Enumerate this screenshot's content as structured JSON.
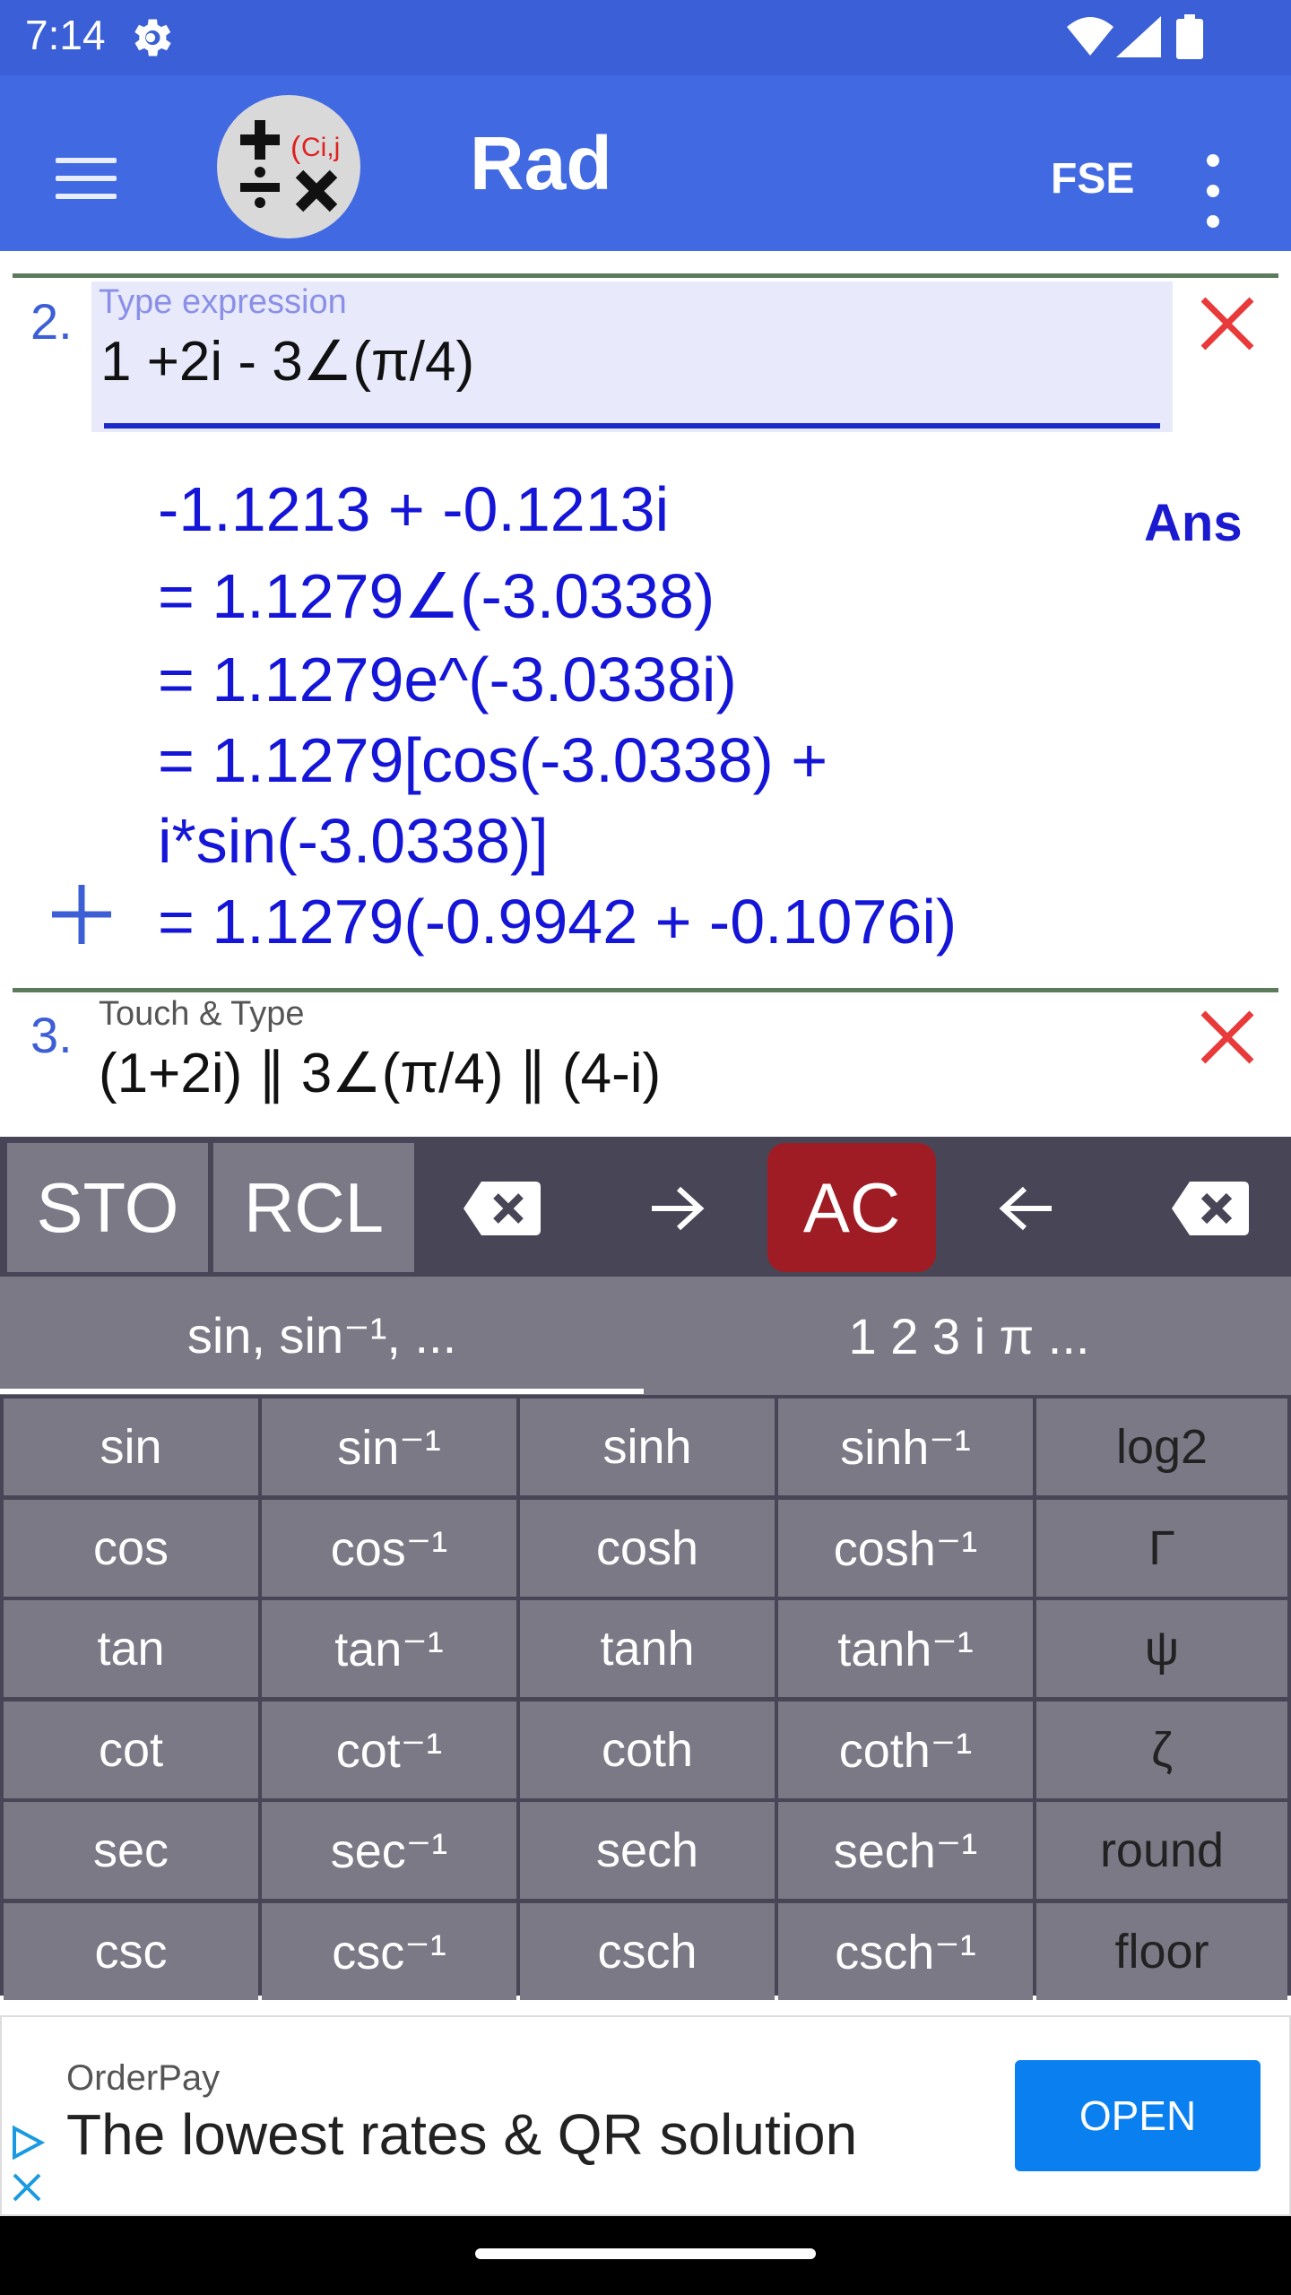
{
  "status_bar": {
    "time": "7:14",
    "icons": [
      "gear-icon",
      "wifi-icon",
      "signal-icon",
      "battery-icon"
    ]
  },
  "app_bar": {
    "icons": [
      "menu-icon",
      "more-vert-icon"
    ],
    "logo_text": "Ci,j",
    "title": "Rad",
    "fse_label": "FSE"
  },
  "entry2": {
    "number": "2.",
    "label": "Type expression",
    "expression": "1 +2i - 3∠(π/4)",
    "results": [
      "-1.1213 + -0.1213i",
      "= 1.1279∠(-3.0338)",
      "= 1.1279e^(-3.0338i)",
      "= 1.1279[cos(-3.0338) +",
      "i*sin(-3.0338)]",
      "= 1.1279(-0.9942 + -0.1076i)"
    ],
    "ans_label": "Ans"
  },
  "entry3": {
    "number": "3.",
    "label": "Touch & Type",
    "expression": "(1+2i) ∥ 3∠(π/4) ∥ (4-i)"
  },
  "toolbar": {
    "sto": "STO",
    "rcl": "RCL",
    "ac": "AC",
    "icons": [
      "clear-entry-icon",
      "arrow-right-icon",
      "arrow-left-icon",
      "backspace-icon"
    ]
  },
  "tabs": [
    {
      "label": "sin, sin⁻¹, ...",
      "active": true
    },
    {
      "label": "1 2 3 i π ...",
      "active": false
    }
  ],
  "keypad": [
    [
      "sin",
      "sin⁻¹",
      "sinh",
      "sinh⁻¹",
      "log2"
    ],
    [
      "cos",
      "cos⁻¹",
      "cosh",
      "cosh⁻¹",
      "Γ"
    ],
    [
      "tan",
      "tan⁻¹",
      "tanh",
      "tanh⁻¹",
      "ψ"
    ],
    [
      "cot",
      "cot⁻¹",
      "coth",
      "coth⁻¹",
      "ζ"
    ],
    [
      "sec",
      "sec⁻¹",
      "sech",
      "sech⁻¹",
      "round"
    ],
    [
      "csc",
      "csc⁻¹",
      "csch",
      "csch⁻¹",
      "floor"
    ]
  ],
  "ad": {
    "brand": "OrderPay",
    "headline": "The lowest rates & QR solution",
    "button": "OPEN"
  },
  "colors": {
    "status_bar": "#3a5fd6",
    "app_bar": "#4169e1",
    "result_text": "#1515d8",
    "ac_button": "#a01c24",
    "keypad_key": "#7a7985",
    "keypad_bg": "#484656",
    "close_icon": "#e83a3a",
    "ad_button": "#0a80f0"
  }
}
